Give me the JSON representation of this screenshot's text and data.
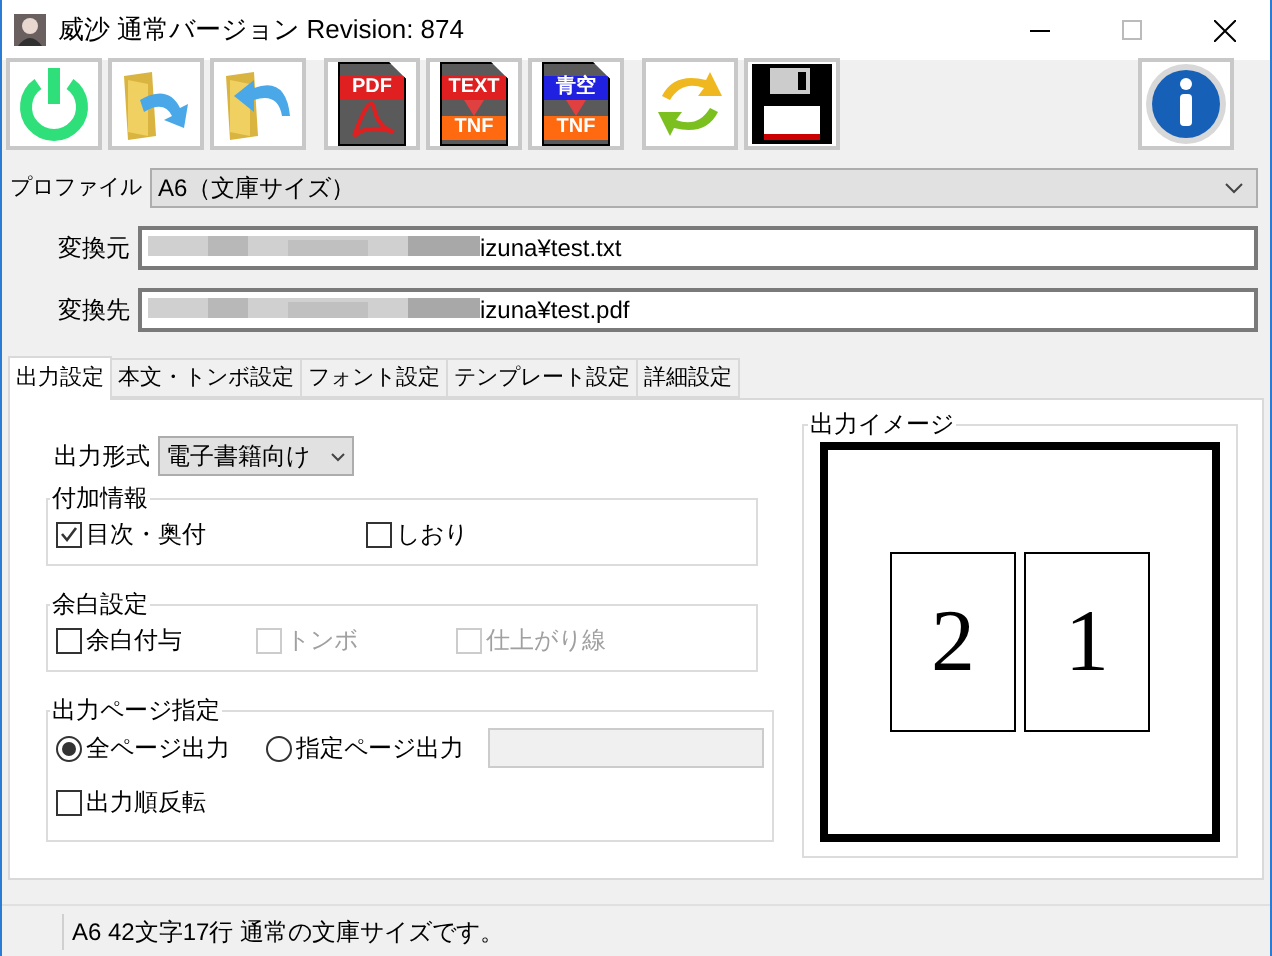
{
  "window": {
    "title": "威沙 通常バージョン Revision: 874"
  },
  "toolbar": [
    {
      "kind": "power"
    },
    {
      "kind": "open"
    },
    {
      "kind": "reopen"
    },
    {
      "kind": "doc",
      "top": "PDF"
    },
    {
      "kind": "doc",
      "top": "TEXT",
      "bottom": "TNF"
    },
    {
      "kind": "doc",
      "top": "青空",
      "bottom": "TNF"
    },
    {
      "kind": "refresh"
    },
    {
      "kind": "save"
    },
    {
      "kind": "info"
    }
  ],
  "profile": {
    "label": "プロファイル",
    "value": "A6（文庫サイズ）"
  },
  "source": {
    "label": "変換元",
    "value": "izuna¥test.txt"
  },
  "destination": {
    "label": "変換先",
    "value": "izuna¥test.pdf"
  },
  "tabs": [
    {
      "label": "出力設定",
      "selected": true
    },
    {
      "label": "本文・トンボ設定",
      "selected": false
    },
    {
      "label": "フォント設定",
      "selected": false
    },
    {
      "label": "テンプレート設定",
      "selected": false
    },
    {
      "label": "詳細設定",
      "selected": false
    }
  ],
  "output_format": {
    "label": "出力形式",
    "value": "電子書籍向け"
  },
  "extra_info": {
    "title": "付加情報",
    "options": [
      {
        "label": "目次・奥付",
        "checked": true,
        "disabled": false
      },
      {
        "label": "しおり",
        "checked": false,
        "disabled": false
      }
    ]
  },
  "margin": {
    "title": "余白設定",
    "options": [
      {
        "label": "余白付与",
        "checked": false,
        "disabled": false
      },
      {
        "label": "トンボ",
        "checked": false,
        "disabled": true
      },
      {
        "label": "仕上がり線",
        "checked": false,
        "disabled": true
      }
    ]
  },
  "pages": {
    "title": "出力ページ指定",
    "radios": [
      {
        "label": "全ページ出力",
        "selected": true
      },
      {
        "label": "指定ページ出力",
        "selected": false
      }
    ],
    "reverse": {
      "label": "出力順反転",
      "checked": false
    }
  },
  "preview": {
    "title": "出力イメージ",
    "pages": [
      "2",
      "1"
    ]
  },
  "status_bar": "A6 42文字17行 通常の文庫サイズです。"
}
